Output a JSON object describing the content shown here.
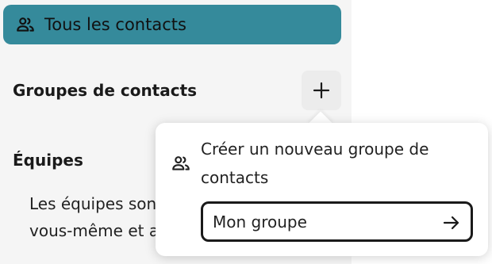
{
  "sidebar": {
    "all_contacts": {
      "label": "Tous les contacts",
      "icon": "users-icon"
    },
    "groups_title": "Groupes de contacts",
    "add_group_icon": "plus-icon",
    "teams_title": "Équipes",
    "teams_description": "Les équipes sont personnes que v vous-même et avec lesquels vous"
  },
  "popover": {
    "icon": "users-icon",
    "title": "Créer un nouveau groupe de contacts",
    "input_value": "Mon groupe",
    "submit_icon": "arrow-right-icon"
  },
  "colors": {
    "accent": "#358a9b",
    "sidebar_bg": "#f5f5f5",
    "text": "#222222"
  }
}
